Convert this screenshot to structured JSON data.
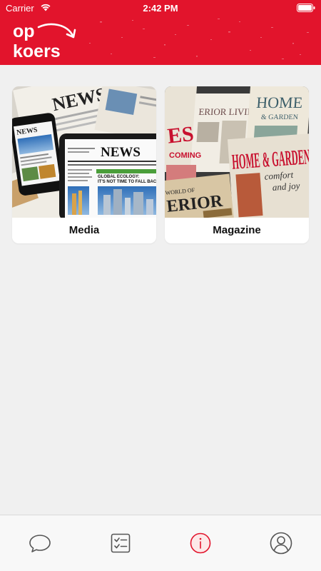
{
  "status_bar": {
    "carrier": "Carrier",
    "time": "2:42 PM"
  },
  "header": {
    "logo_text_top": "op",
    "logo_text_bottom": "koers",
    "brand_color": "#e2142c"
  },
  "cards": [
    {
      "label": "Media",
      "image_text_primary": "NEWS",
      "image_text_secondary": "GLOBAL ECOLOGY: IT'S NOT TIME TO FALL BACK"
    },
    {
      "label": "Magazine",
      "image_text_primary": "HOME & GARDEN",
      "image_text_secondary": "INTERIOR LIVING"
    }
  ],
  "tabbar": {
    "tabs": [
      {
        "icon": "chat-bubble-icon",
        "active": false
      },
      {
        "icon": "checklist-icon",
        "active": false
      },
      {
        "icon": "info-icon",
        "active": true
      },
      {
        "icon": "profile-icon",
        "active": false
      }
    ],
    "active_color": "#e2142c",
    "inactive_color": "#555555"
  }
}
